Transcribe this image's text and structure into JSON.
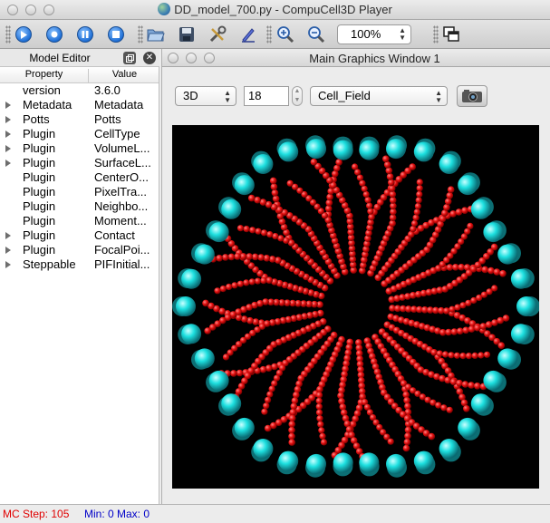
{
  "window": {
    "title": "DD_model_700.py - CompuCell3D Player"
  },
  "toolbar": {
    "run_icon": "run-icon",
    "step_icon": "step-icon",
    "pause_icon": "pause-icon",
    "stop_icon": "stop-icon",
    "open_icon": "folder-open-icon",
    "save_icon": "save-icon",
    "settings_icon": "tools-icon",
    "edit_icon": "pencil-icon",
    "zoom_in_icon": "zoom-in-icon",
    "zoom_out_icon": "zoom-out-icon",
    "zoom_value": "100%",
    "layout_icon": "windows-icon"
  },
  "model_editor": {
    "title": "Model Editor",
    "columns": {
      "property": "Property",
      "value": "Value"
    },
    "rows": [
      {
        "property": "version",
        "value": "3.6.0",
        "expandable": false
      },
      {
        "property": "Metadata",
        "value": "Metadata",
        "expandable": true
      },
      {
        "property": "Potts",
        "value": "Potts",
        "expandable": true
      },
      {
        "property": "Plugin",
        "value": "CellType",
        "expandable": true
      },
      {
        "property": "Plugin",
        "value": "VolumeL...",
        "expandable": true
      },
      {
        "property": "Plugin",
        "value": "SurfaceL...",
        "expandable": true
      },
      {
        "property": "Plugin",
        "value": "CenterO...",
        "expandable": false
      },
      {
        "property": "Plugin",
        "value": "PixelTra...",
        "expandable": false
      },
      {
        "property": "Plugin",
        "value": "Neighbo...",
        "expandable": false
      },
      {
        "property": "Plugin",
        "value": "Moment...",
        "expandable": false
      },
      {
        "property": "Plugin",
        "value": "Contact",
        "expandable": true
      },
      {
        "property": "Plugin",
        "value": "FocalPoi...",
        "expandable": true
      },
      {
        "property": "Steppable",
        "value": "PIFInitial...",
        "expandable": true
      }
    ]
  },
  "graphics_window": {
    "title": "Main Graphics Window 1",
    "view_mode": "3D",
    "depth": "18",
    "field": "Cell_Field",
    "screenshot_icon": "camera-icon",
    "colors": {
      "background": "#000000",
      "cyan_cells": "#1de0e0",
      "red_cells": "#e51010"
    }
  },
  "status": {
    "mc_step": "MC Step: 105",
    "min_max": "Min: 0 Max: 0"
  }
}
